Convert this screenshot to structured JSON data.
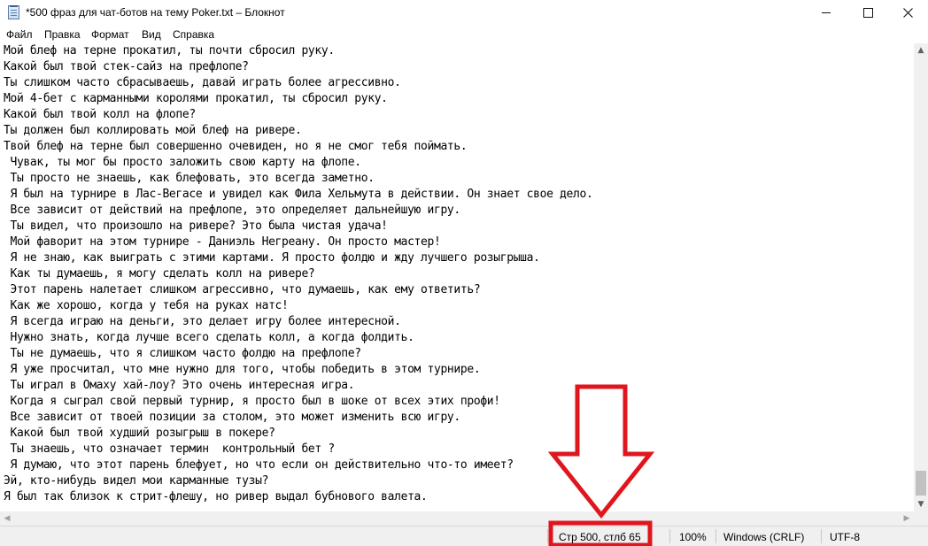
{
  "window": {
    "title": "*500 фраз для чат-ботов на тему Poker.txt – Блокнот"
  },
  "menu": [
    "Файл",
    "Правка",
    "Формат",
    "Вид",
    "Справка"
  ],
  "editor": {
    "lines": [
      "Мой блеф на терне прокатил, ты почти сбросил руку.",
      "Какой был твой стек-сайз на префлопе?",
      "Ты слишком часто сбрасываешь, давай играть более агрессивно.",
      "Мой 4-бет с карманными королями прокатил, ты сбросил руку.",
      "Какой был твой колл на флопе?",
      "Ты должен был коллировать мой блеф на ривере.",
      "Твой блеф на терне был совершенно очевиден, но я не смог тебя поймать.",
      " Чувак, ты мог бы просто заложить свою карту на флопе.",
      " Ты просто не знаешь, как блефовать, это всегда заметно.",
      " Я был на турнире в Лас-Вегасе и увидел как Фила Хельмута в действии. Он знает свое дело.",
      " Все зависит от действий на префлопе, это определяет дальнейшую игру.",
      " Ты видел, что произошло на ривере? Это была чистая удача!",
      " Мой фаворит на этом турнире - Даниэль Негреану. Он просто мастер!",
      " Я не знаю, как выиграть с этими картами. Я просто фолдю и жду лучшего розыгрыша.",
      " Как ты думаешь, я могу сделать колл на ривере?",
      " Этот парень налетает слишком агрессивно, что думаешь, как ему ответить?",
      " Как же хорошо, когда у тебя на руках натс!",
      " Я всегда играю на деньги, это делает игру более интересной.",
      " Нужно знать, когда лучше всего сделать колл, а когда фолдить.",
      " Ты не думаешь, что я слишком часто фолдю на префлопе?",
      " Я уже просчитал, что мне нужно для того, чтобы победить в этом турнире.",
      " Ты играл в Омаху хай-лоу? Это очень интересная игра.",
      " Когда я сыграл свой первый турнир, я просто был в шоке от всех этих профи!",
      " Все зависит от твоей позиции за столом, это может изменить всю игру.",
      " Какой был твой худший розыгрыш в покере?",
      " Ты знаешь, что означает термин  контрольный бет ?",
      " Я думаю, что этот парень блефует, но что если он действительно что-то имеет?",
      "Эй, кто-нибудь видел мои карманные тузы?",
      "Я был так близок к стрит-флешу, но ривер выдал бубнового валета."
    ]
  },
  "status": {
    "position": "Стр 500, стлб 65",
    "zoom": "100%",
    "line_endings": "Windows (CRLF)",
    "encoding": "UTF-8"
  },
  "annotation": {
    "color": "#e0161e"
  }
}
